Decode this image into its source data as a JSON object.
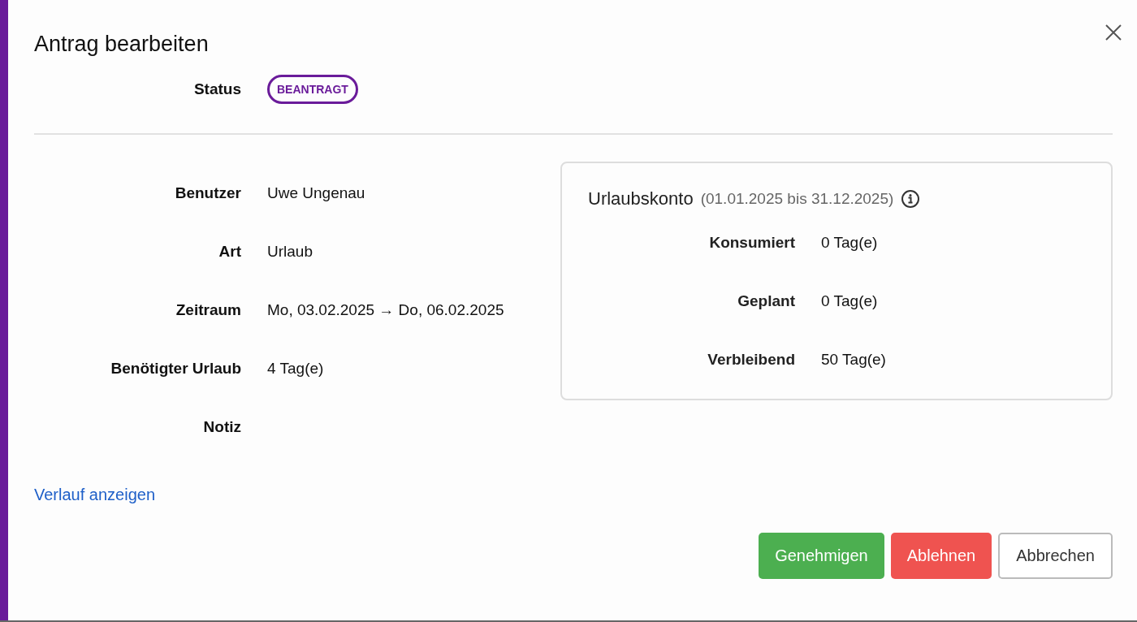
{
  "dialog": {
    "title": "Antrag bearbeiten",
    "status": {
      "label": "Status",
      "value": "BEANTRAGT"
    }
  },
  "fields": [
    {
      "label": "Benutzer",
      "value": "Uwe Ungenau"
    },
    {
      "label": "Art",
      "value": "Urlaub"
    },
    {
      "label": "Zeitraum",
      "value": "Mo, 03.02.2025 → Do, 06.02.2025"
    },
    {
      "label": "Benötigter Urlaub",
      "value": "4 Tag(e)"
    },
    {
      "label": "Notiz"
    }
  ],
  "account": {
    "title": "Urlaubskonto",
    "period": "(01.01.2025 bis 31.12.2025)",
    "rows": [
      {
        "label": "Konsumiert",
        "value": "0 Tag(e)"
      },
      {
        "label": "Geplant",
        "value": "0 Tag(e)"
      },
      {
        "label": "Verbleibend",
        "value": "50 Tag(e)"
      }
    ]
  },
  "history_link": "Verlauf anzeigen",
  "buttons": [
    {
      "label": "Genehmigen",
      "kind": "approve"
    },
    {
      "label": "Ablehnen",
      "kind": "reject"
    },
    {
      "label": "Abbrechen",
      "kind": "cancel"
    }
  ]
}
